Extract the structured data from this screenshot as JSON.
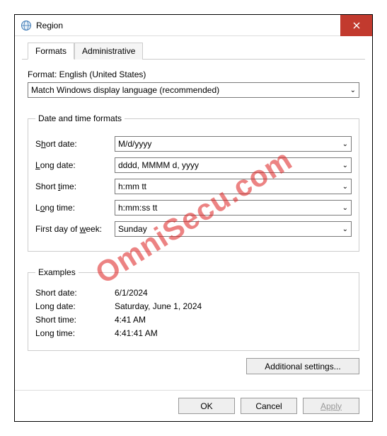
{
  "window": {
    "title": "Region"
  },
  "tabs": {
    "formats": "Formats",
    "administrative": "Administrative"
  },
  "format": {
    "label": "Format: English (United States)",
    "value": "Match Windows display language (recommended)"
  },
  "dt_group": {
    "legend": "Date and time formats",
    "rows": {
      "short_date": {
        "label_pre": "S",
        "label_u": "h",
        "label_post": "ort date:",
        "value": "M/d/yyyy"
      },
      "long_date": {
        "label_pre": "",
        "label_u": "L",
        "label_post": "ong date:",
        "value": "dddd, MMMM d, yyyy"
      },
      "short_time": {
        "label_pre": "Short ",
        "label_u": "t",
        "label_post": "ime:",
        "value": "h:mm tt"
      },
      "long_time": {
        "label_pre": "L",
        "label_u": "o",
        "label_post": "ng time:",
        "value": "h:mm:ss tt"
      },
      "first_day": {
        "label_pre": "First day of ",
        "label_u": "w",
        "label_post": "eek:",
        "value": "Sunday"
      }
    }
  },
  "examples": {
    "legend": "Examples",
    "rows": {
      "short_date": {
        "label": "Short date:",
        "value": "6/1/2024"
      },
      "long_date": {
        "label": "Long date:",
        "value": "Saturday, June 1, 2024"
      },
      "short_time": {
        "label": "Short time:",
        "value": "4:41 AM"
      },
      "long_time": {
        "label": "Long time:",
        "value": "4:41:41 AM"
      }
    }
  },
  "buttons": {
    "additional": "Additional settings...",
    "ok": "OK",
    "cancel": "Cancel",
    "apply": "Apply"
  },
  "watermark": "OmniSecu.com"
}
